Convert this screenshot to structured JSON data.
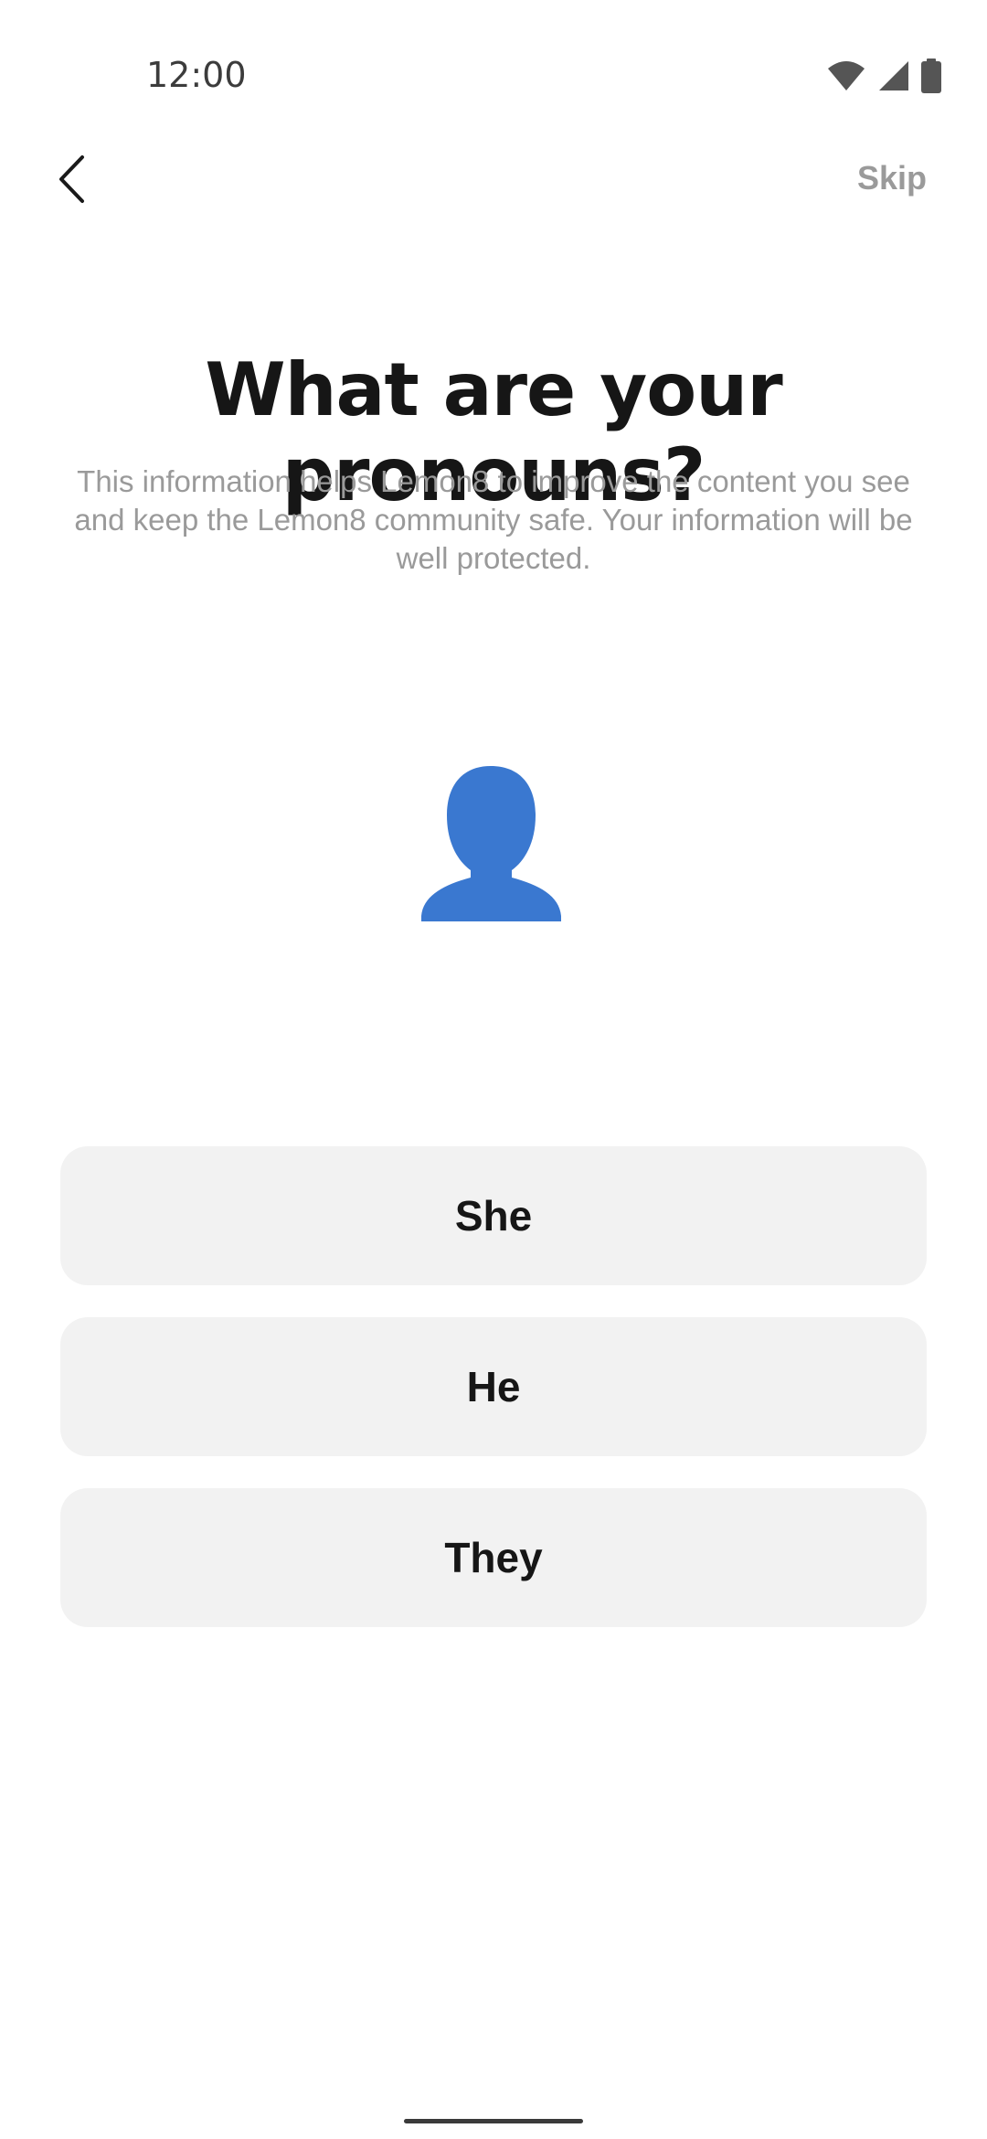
{
  "status_bar": {
    "time": "12:00",
    "icons": [
      "wifi-icon",
      "cell-signal-icon",
      "battery-icon"
    ]
  },
  "nav": {
    "back_icon": "chevron-left-icon",
    "skip_label": "Skip"
  },
  "main": {
    "title": "What are your pronouns?",
    "subtitle": "This information helps Lemon8 to improve the content you see and keep the Lemon8 community safe. Your information will be well protected.",
    "avatar_icon": "person-silhouette-icon",
    "options": [
      {
        "label": "She"
      },
      {
        "label": "He"
      },
      {
        "label": "They"
      }
    ]
  },
  "colors": {
    "title": "#161616",
    "subtitle": "#9a9a9a",
    "skip": "#9a9a9a",
    "option_bg": "#f2f2f2",
    "avatar": "#3a78d0"
  }
}
